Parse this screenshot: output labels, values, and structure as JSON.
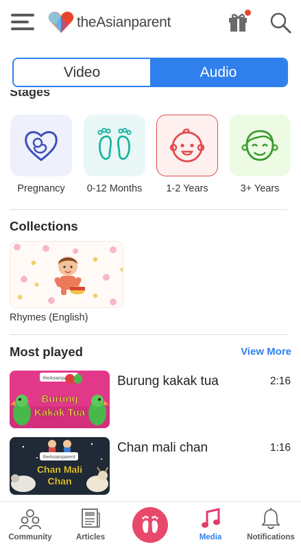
{
  "header": {
    "logo_text": "theAsianparent",
    "icons": [
      "menu-icon",
      "heart-logo-icon",
      "gift-icon",
      "search-icon"
    ]
  },
  "toggle": {
    "video_label": "Video",
    "audio_label": "Audio",
    "selected": "Audio"
  },
  "stages": {
    "title": "Stages",
    "items": [
      {
        "label": "Pregnancy",
        "icon": "pregnancy-heart-icon",
        "bg": "#eef0fc"
      },
      {
        "label": "0-12 Months",
        "icon": "baby-feet-icon",
        "bg": "#e9f8f6"
      },
      {
        "label": "1-2 Years",
        "icon": "baby-face-icon",
        "bg": "#fdf0ef"
      },
      {
        "label": "3+ Years",
        "icon": "kid-face-icon",
        "bg": "#eefbe4"
      }
    ]
  },
  "collections": {
    "title": "Collections",
    "items": [
      {
        "label": "Rhymes (English)"
      }
    ]
  },
  "most_played": {
    "title": "Most played",
    "view_more": "View More",
    "tracks": [
      {
        "title": "Burung kakak tua",
        "duration": "2:16",
        "thumb_text_1": "Burung",
        "thumb_text_2": "Kakak Tua",
        "brand": "theAsianparent"
      },
      {
        "title": "Chan mali chan",
        "duration": "1:16",
        "thumb_text_1": "Chan Mali",
        "thumb_text_2": "Chan",
        "brand": "theAsianparent"
      }
    ]
  },
  "bottom_nav": {
    "items": [
      {
        "label": "Community",
        "icon": "community-icon"
      },
      {
        "label": "Articles",
        "icon": "newspaper-icon"
      },
      {
        "label": "",
        "icon": "baby-feet-icon"
      },
      {
        "label": "Media",
        "icon": "music-note-icon"
      },
      {
        "label": "Notifications",
        "icon": "bell-icon"
      }
    ],
    "active": "Media"
  },
  "colors": {
    "accent": "#2f80ed",
    "brand_pink": "#e8486a",
    "notification_dot": "#e8452f"
  }
}
